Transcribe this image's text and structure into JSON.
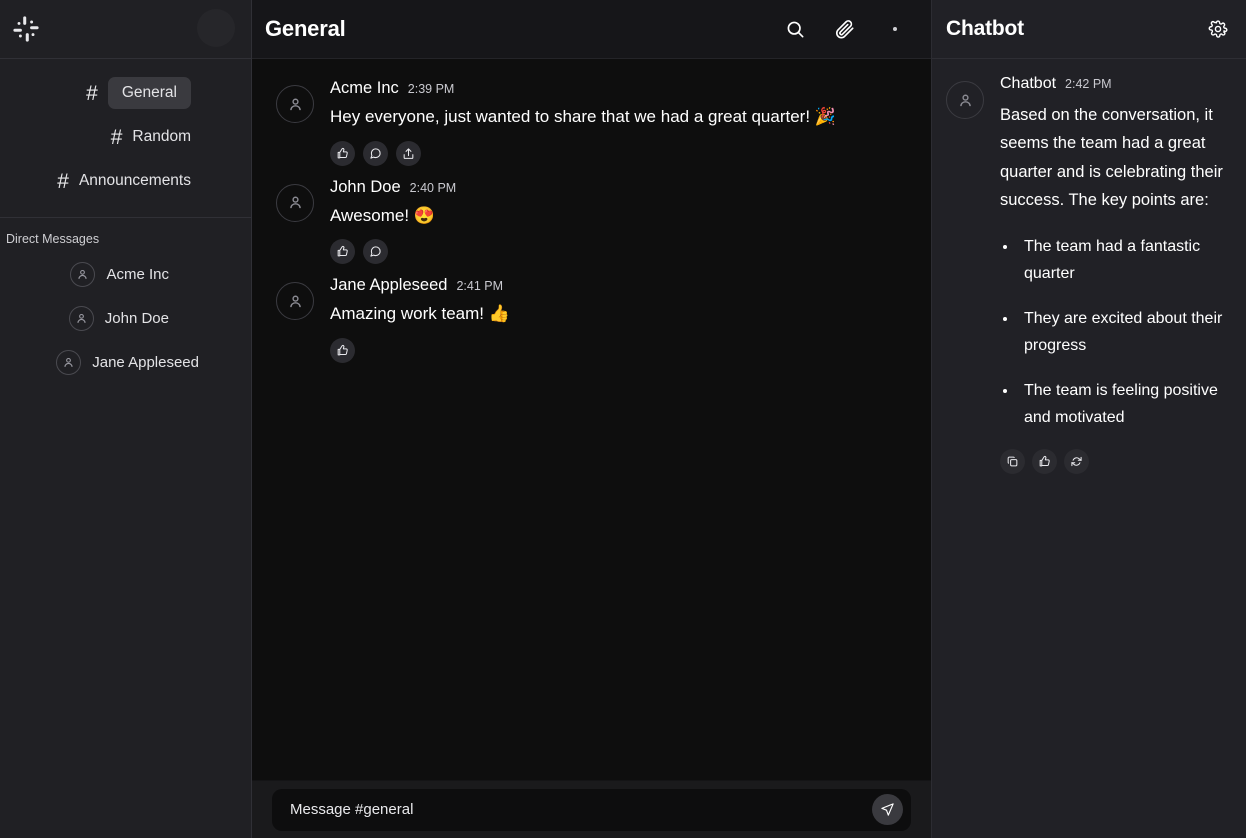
{
  "sidebar": {
    "logo_icon": "slack-logo-icon",
    "channels": [
      {
        "hash": "#",
        "label": "General",
        "active": true
      },
      {
        "hash": "#",
        "label": "Random",
        "active": false
      },
      {
        "hash": "#",
        "label": "Announcements",
        "active": false
      }
    ],
    "dm_section_title": "Direct Messages",
    "dms": [
      {
        "name": "Acme Inc",
        "avatar_icon": "person-icon"
      },
      {
        "name": "John Doe",
        "avatar_icon": "person-icon"
      },
      {
        "name": "Jane Appleseed",
        "avatar_icon": "person-icon"
      }
    ]
  },
  "channel_header": {
    "title": "General",
    "search_icon": "search-icon",
    "attach_icon": "paperclip-icon",
    "more_icon": "more-dot-icon"
  },
  "messages": [
    {
      "author": "Acme Inc",
      "time": "2:39 PM",
      "text": "Hey everyone, just wanted to share that we had a great quarter! 🎉",
      "actions": [
        "thumbs-up-icon",
        "comment-icon",
        "share-icon"
      ]
    },
    {
      "author": "John Doe",
      "time": "2:40 PM",
      "text": "Awesome! 😍",
      "actions": [
        "thumbs-up-icon",
        "comment-icon"
      ]
    },
    {
      "author": "Jane Appleseed",
      "time": "2:41 PM",
      "text": "Amazing work team! 👍",
      "actions": [
        "thumbs-up-icon"
      ]
    }
  ],
  "composer": {
    "placeholder": "Message #general",
    "value": "",
    "send_icon": "send-icon"
  },
  "chatbot_panel": {
    "title": "Chatbot",
    "settings_icon": "gear-icon",
    "message": {
      "author": "Chatbot",
      "time": "2:42 PM",
      "text": "Based on the conversation, it seems the team had a great quarter and is celebrating their success. The key points are:",
      "bullets": [
        "The team had a fantastic quarter",
        "They are excited about their progress",
        "The team is feeling positive and motivated"
      ],
      "actions": [
        "copy-icon",
        "thumbs-up-icon",
        "regenerate-icon"
      ]
    }
  },
  "colors": {
    "sidebar_bg": "#202024",
    "center_bg": "#0e0e0e",
    "panel_bg": "#212126",
    "active_pill": "#3a3a3f",
    "chip_bg": "#2b2b30",
    "text_primary": "#ffffff",
    "text_muted": "#c9c9cf"
  }
}
